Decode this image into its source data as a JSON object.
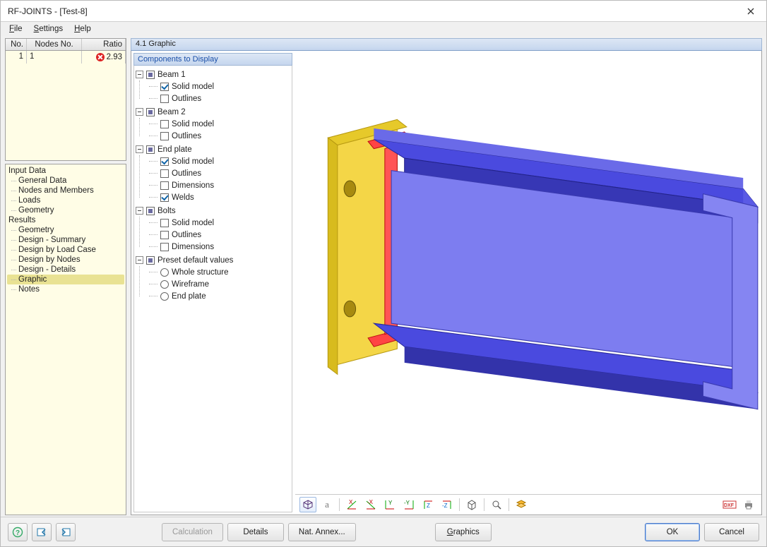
{
  "window": {
    "title": "RF-JOINTS - [Test-8]"
  },
  "menu": {
    "file": "File",
    "settings": "Settings",
    "help": "Help"
  },
  "grid": {
    "headers": {
      "no": "No.",
      "nodes": "Nodes No.",
      "ratio": "Ratio"
    },
    "rows": [
      {
        "no": "1",
        "nodes": "1",
        "ratio": "2.93",
        "status": "error"
      }
    ]
  },
  "nav": {
    "input_section": "Input Data",
    "input_items": [
      "General Data",
      "Nodes and Members",
      "Loads",
      "Geometry"
    ],
    "results_section": "Results",
    "results_items": [
      "Geometry",
      "Design - Summary",
      "Design by Load Case",
      "Design by Nodes",
      "Design - Details",
      "Graphic",
      "Notes"
    ],
    "selected": "Graphic"
  },
  "panel": {
    "title": "4.1 Graphic",
    "comp_header": "Components to Display"
  },
  "tree": {
    "beam1": {
      "label": "Beam 1",
      "solid": "Solid model",
      "outlines": "Outlines"
    },
    "beam2": {
      "label": "Beam 2",
      "solid": "Solid model",
      "outlines": "Outlines"
    },
    "endplate": {
      "label": "End plate",
      "solid": "Solid model",
      "outlines": "Outlines",
      "dims": "Dimensions",
      "welds": "Welds"
    },
    "bolts": {
      "label": "Bolts",
      "solid": "Solid model",
      "outlines": "Outlines",
      "dims": "Dimensions"
    },
    "presets": {
      "label": "Preset default values",
      "whole": "Whole structure",
      "wire": "Wireframe",
      "end": "End plate"
    }
  },
  "toolbar3d": {
    "items": [
      "isometric-view",
      "text-tool",
      "view-x",
      "view-neg-x",
      "view-y",
      "view-neg-y",
      "view-z",
      "view-neg-z",
      "box-view",
      "zoom-window",
      "layers"
    ],
    "right_items": [
      "dxf-export",
      "print"
    ]
  },
  "buttons": {
    "help": "?",
    "prev": "prev",
    "next": "next",
    "calculation": "Calculation",
    "details": "Details",
    "nat_annex": "Nat. Annex...",
    "graphics": "Graphics",
    "ok": "OK",
    "cancel": "Cancel"
  }
}
